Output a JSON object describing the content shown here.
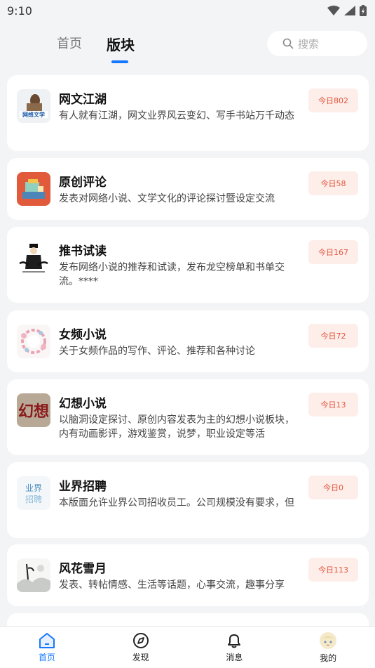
{
  "status": {
    "time": "9:10"
  },
  "header": {
    "tabs": [
      {
        "label": "首页",
        "active": false
      },
      {
        "label": "版块",
        "active": true
      }
    ],
    "search": {
      "placeholder": "搜索"
    }
  },
  "forums": [
    {
      "title": "网文江湖",
      "desc": "有人就有江湖，网文业界风云变幻、写手书站万千动态",
      "today": "今日802",
      "icon": "wangwen-jianghu-icon",
      "icon_text": "网络文学"
    },
    {
      "title": "原创评论",
      "desc": "发表对网络小说、文学文化的评论探讨暨设定交流",
      "today": "今日58",
      "icon": "books-desk-icon"
    },
    {
      "title": "推书试读",
      "desc": "发布网络小说的推荐和试读，发布龙空榜单和书单交流。****",
      "today": "今日167",
      "icon": "scholar-figure-icon"
    },
    {
      "title": "女频小说",
      "desc": "关于女频作品的写作、评论、推荐和各种讨论",
      "today": "今日72",
      "icon": "flower-wreath-icon"
    },
    {
      "title": "幻想小说",
      "desc": "以脑洞设定探讨、原创内容发表为主的幻想小说板块，内有动画影评，游戏鉴赏，说梦，职业设定等活",
      "today": "今日13",
      "icon": "huanxiang-calligraphy-icon",
      "icon_text": "幻想"
    },
    {
      "title": "业界招聘",
      "desc": "本版面允许业界公司招收员工。公司规模没有要求，但",
      "today": "今日0",
      "icon": "yejie-zhaopin-icon",
      "icon_text": "业界招聘"
    },
    {
      "title": "风花雪月",
      "desc": "发表、转帖情感、生活等话题，心事交流，趣事分享",
      "today": "今日113",
      "icon": "ink-landscape-icon"
    }
  ],
  "bottom_nav": [
    {
      "label": "首页",
      "icon": "home-icon",
      "active": true
    },
    {
      "label": "发现",
      "icon": "compass-icon",
      "active": false
    },
    {
      "label": "消息",
      "icon": "bell-icon",
      "active": false
    },
    {
      "label": "我的",
      "icon": "avatar-icon",
      "active": false
    }
  ],
  "colors": {
    "accent": "#1677ff",
    "badge_bg": "#fdeeea",
    "badge_text": "#e4553b"
  }
}
